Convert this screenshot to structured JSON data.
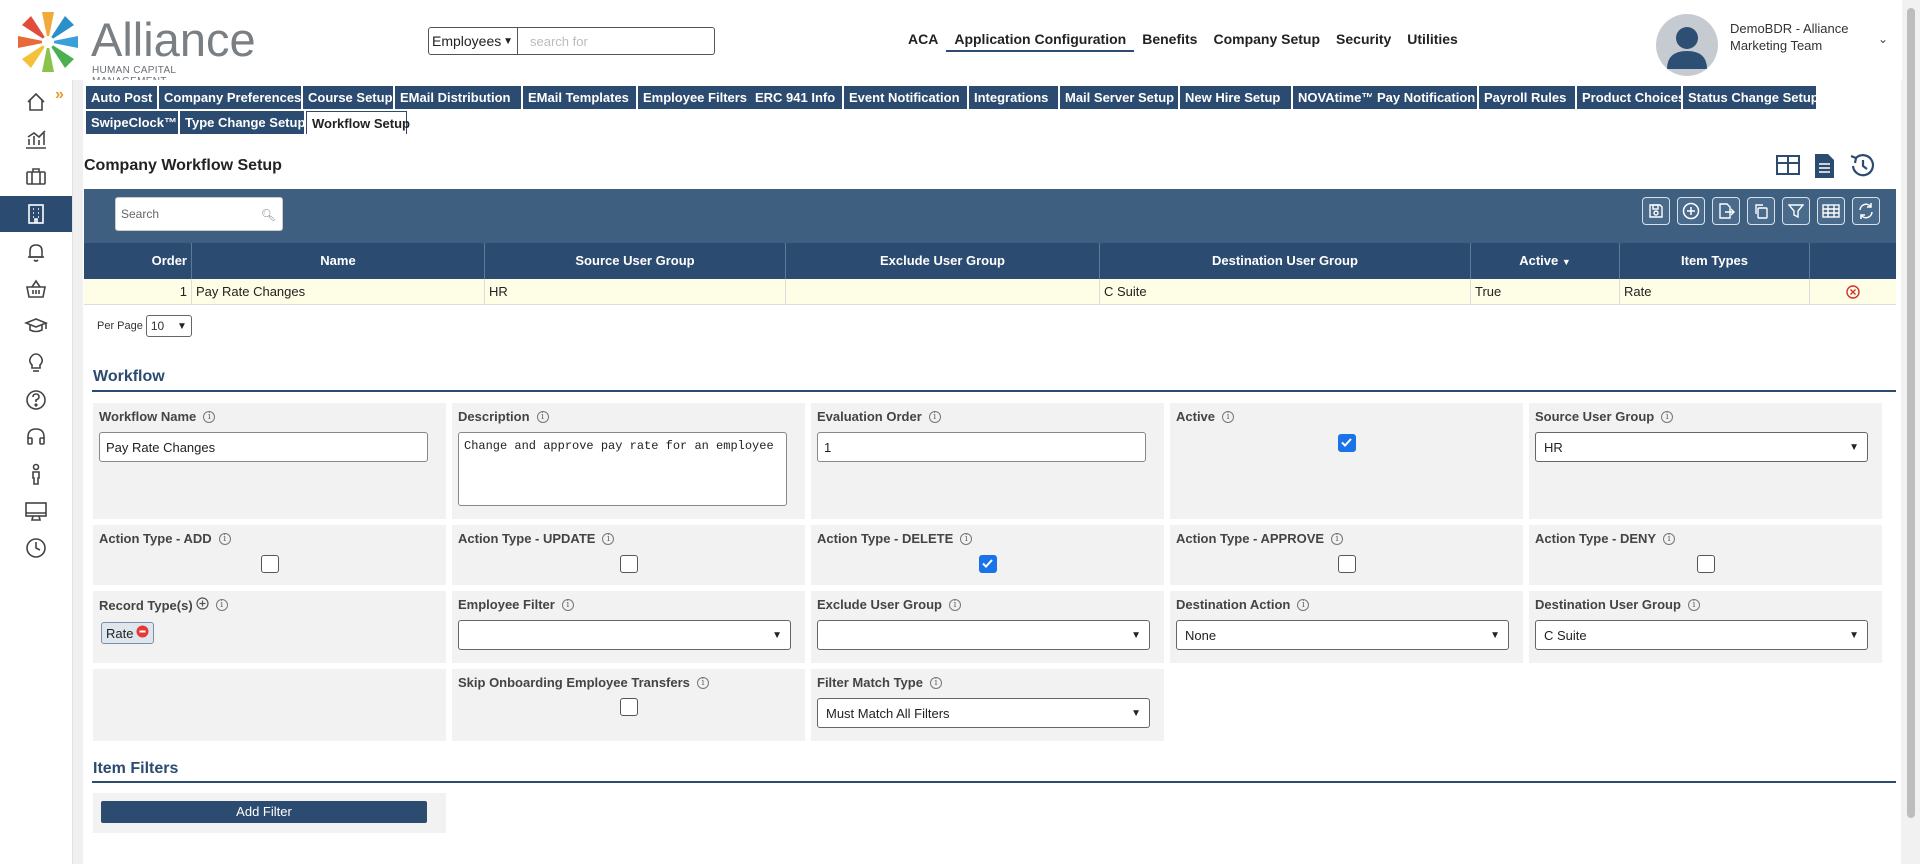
{
  "brand": {
    "name": "Alliance",
    "tagline": "HUMAN CAPITAL MANAGEMENT"
  },
  "header_search": {
    "scope": "Employees",
    "placeholder": "search for"
  },
  "topnav": [
    "ACA",
    "Application Configuration",
    "Benefits",
    "Company Setup",
    "Security",
    "Utilities"
  ],
  "user": {
    "name": "DemoBDR - Alliance Marketing Team"
  },
  "sidebar_icons": [
    "home-icon",
    "analytics-icon",
    "briefcase-icon",
    "building-icon",
    "bell-icon",
    "basket-icon",
    "graduation-cap-icon",
    "lightbulb-icon",
    "help-icon",
    "headset-icon",
    "person-icon",
    "monitor-icon",
    "clock-icon"
  ],
  "tabs": {
    "row1": [
      "Auto Post",
      "Company Preferences",
      "Course Setup",
      "EMail Distribution",
      "EMail Templates",
      "Employee Filters",
      "ERC 941 Info",
      "Event Notification",
      "Integrations",
      "Mail Server Setup",
      "New Hire Setup",
      "NOVAtime™",
      "Pay Notification",
      "Payroll Rules",
      "Product Choices",
      "Status Change Setup"
    ],
    "row2": [
      "SwipeClock™",
      "Type Change Setup",
      "Workflow Setup"
    ],
    "active": "Workflow Setup"
  },
  "page_title": "Company Workflow Setup",
  "grid": {
    "search_placeholder": "Search",
    "columns": [
      "Order",
      "Name",
      "Source User Group",
      "Exclude User Group",
      "Destination User Group",
      "Active",
      "Item Types"
    ],
    "sort_column": "Active",
    "rows": [
      {
        "order": "1",
        "name": "Pay Rate Changes",
        "source": "HR",
        "exclude": "",
        "destination": "C Suite",
        "active": "True",
        "item_types": "Rate"
      }
    ],
    "per_page_label": "Per Page",
    "per_page": "10"
  },
  "workflow": {
    "section_title": "Workflow",
    "workflow_name": {
      "label": "Workflow Name",
      "value": "Pay Rate Changes"
    },
    "description": {
      "label": "Description",
      "value": "Change and approve pay rate for an employee"
    },
    "evaluation_order": {
      "label": "Evaluation Order",
      "value": "1"
    },
    "active": {
      "label": "Active",
      "checked": true
    },
    "source_user_group": {
      "label": "Source User Group",
      "value": "HR"
    },
    "action_add": {
      "label": "Action Type - ADD",
      "checked": false
    },
    "action_update": {
      "label": "Action Type - UPDATE",
      "checked": false
    },
    "action_delete": {
      "label": "Action Type - DELETE",
      "checked": true
    },
    "action_approve": {
      "label": "Action Type - APPROVE",
      "checked": false
    },
    "action_deny": {
      "label": "Action Type - DENY",
      "checked": false
    },
    "record_types": {
      "label": "Record Type(s)",
      "chips": [
        "Rate"
      ]
    },
    "employee_filter": {
      "label": "Employee Filter",
      "value": ""
    },
    "exclude_user_group": {
      "label": "Exclude User Group",
      "value": ""
    },
    "destination_action": {
      "label": "Destination Action",
      "value": "None"
    },
    "destination_user_group": {
      "label": "Destination User Group",
      "value": "C Suite"
    },
    "skip_onboarding": {
      "label": "Skip Onboarding Employee Transfers",
      "checked": false
    },
    "filter_match_type": {
      "label": "Filter Match Type",
      "value": "Must Match All Filters"
    }
  },
  "item_filters": {
    "section_title": "Item Filters",
    "add_button": "Add Filter"
  },
  "colors": {
    "primary": "#2c4b70",
    "toolbar": "#3f5f80",
    "row_highlight": "#fefde6",
    "accent": "#e89a2e",
    "checkbox": "#1a73e8"
  }
}
